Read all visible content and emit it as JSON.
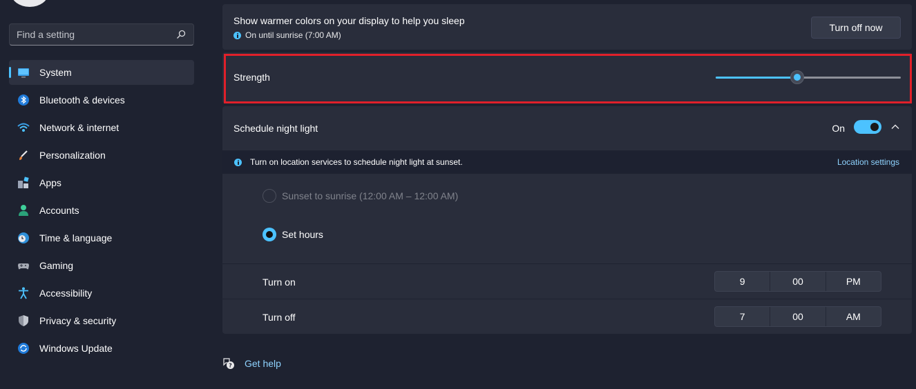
{
  "search": {
    "placeholder": "Find a setting"
  },
  "sidebar": {
    "items": [
      {
        "label": "System",
        "active": true
      },
      {
        "label": "Bluetooth & devices"
      },
      {
        "label": "Network & internet"
      },
      {
        "label": "Personalization"
      },
      {
        "label": "Apps"
      },
      {
        "label": "Accounts"
      },
      {
        "label": "Time & language"
      },
      {
        "label": "Gaming"
      },
      {
        "label": "Accessibility"
      },
      {
        "label": "Privacy & security"
      },
      {
        "label": "Windows Update"
      }
    ]
  },
  "night_light": {
    "status_title": "Show warmer colors on your display to help you sleep",
    "status_sub": "On until sunrise (7:00 AM)",
    "turn_off_label": "Turn off now",
    "strength_label": "Strength",
    "strength_value": 0.44,
    "schedule_label": "Schedule night light",
    "schedule_state": "On",
    "info_text": "Turn on location services to schedule night light at sunset.",
    "location_link": "Location settings",
    "option_sunset": "Sunset to sunrise (12:00 AM – 12:00 AM)",
    "option_set_hours": "Set hours",
    "turn_on": {
      "label": "Turn on",
      "hour": "9",
      "minute": "00",
      "period": "PM"
    },
    "turn_off": {
      "label": "Turn off",
      "hour": "7",
      "minute": "00",
      "period": "AM"
    }
  },
  "help": {
    "label": "Get help"
  },
  "colors": {
    "accent": "#4cc2ff",
    "highlight": "#e0202a",
    "background": "#1e2230",
    "card": "#292d3b"
  }
}
